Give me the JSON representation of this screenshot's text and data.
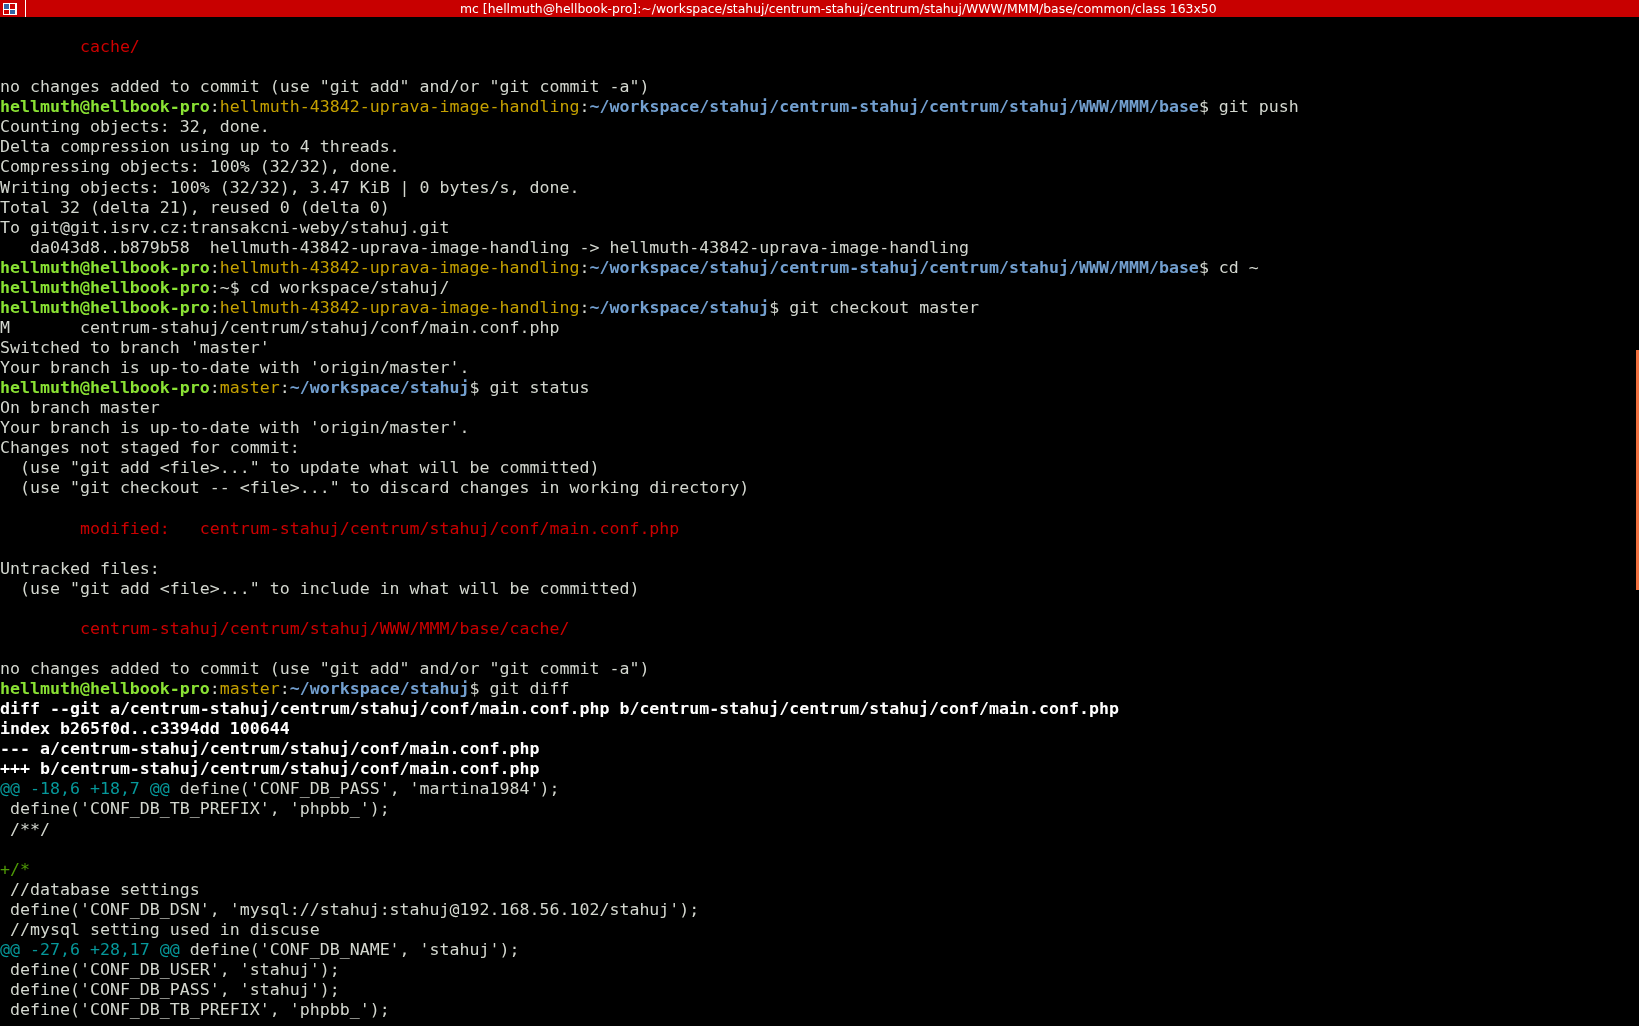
{
  "window": {
    "title": "mc [hellmuth@hellbook-pro]:~/workspace/stahuj/centrum-stahuj/centrum/stahuj/WWW/MMM/base/common/class 163x50"
  },
  "lines": [
    {
      "kind": "blank"
    },
    {
      "kind": "text",
      "segments": [
        {
          "kind": "red",
          "text": "        cache/"
        }
      ]
    },
    {
      "kind": "blank"
    },
    {
      "kind": "text",
      "segments": [
        {
          "kind": "plain",
          "text": "no changes added to commit (use \"git add\" and/or \"git commit -a\")"
        }
      ]
    },
    {
      "kind": "text",
      "segments": [
        {
          "kind": "user",
          "text": "hellmuth@hellbook-pro"
        },
        {
          "kind": "plain",
          "text": ":"
        },
        {
          "kind": "branch",
          "text": "hellmuth-43842-uprava-image-handling"
        },
        {
          "kind": "plain",
          "text": ":"
        },
        {
          "kind": "path",
          "text": "~/workspace/stahuj/centrum-stahuj/centrum/stahuj/WWW/MMM/base"
        },
        {
          "kind": "plain",
          "text": "$ git push"
        }
      ]
    },
    {
      "kind": "text",
      "segments": [
        {
          "kind": "plain",
          "text": "Counting objects: 32, done."
        }
      ]
    },
    {
      "kind": "text",
      "segments": [
        {
          "kind": "plain",
          "text": "Delta compression using up to 4 threads."
        }
      ]
    },
    {
      "kind": "text",
      "segments": [
        {
          "kind": "plain",
          "text": "Compressing objects: 100% (32/32), done."
        }
      ]
    },
    {
      "kind": "text",
      "segments": [
        {
          "kind": "plain",
          "text": "Writing objects: 100% (32/32), 3.47 KiB | 0 bytes/s, done."
        }
      ]
    },
    {
      "kind": "text",
      "segments": [
        {
          "kind": "plain",
          "text": "Total 32 (delta 21), reused 0 (delta 0)"
        }
      ]
    },
    {
      "kind": "text",
      "segments": [
        {
          "kind": "plain",
          "text": "To git@git.isrv.cz:transakcni-weby/stahuj.git"
        }
      ]
    },
    {
      "kind": "text",
      "segments": [
        {
          "kind": "plain",
          "text": "   da043d8..b879b58  hellmuth-43842-uprava-image-handling -> hellmuth-43842-uprava-image-handling"
        }
      ]
    },
    {
      "kind": "text",
      "segments": [
        {
          "kind": "user",
          "text": "hellmuth@hellbook-pro"
        },
        {
          "kind": "plain",
          "text": ":"
        },
        {
          "kind": "branch",
          "text": "hellmuth-43842-uprava-image-handling"
        },
        {
          "kind": "plain",
          "text": ":"
        },
        {
          "kind": "path",
          "text": "~/workspace/stahuj/centrum-stahuj/centrum/stahuj/WWW/MMM/base"
        },
        {
          "kind": "plain",
          "text": "$ cd ~"
        }
      ]
    },
    {
      "kind": "text",
      "segments": [
        {
          "kind": "user",
          "text": "hellmuth@hellbook-pro"
        },
        {
          "kind": "plain",
          "text": ":~$ cd workspace/stahuj/"
        }
      ]
    },
    {
      "kind": "text",
      "segments": [
        {
          "kind": "user",
          "text": "hellmuth@hellbook-pro"
        },
        {
          "kind": "plain",
          "text": ":"
        },
        {
          "kind": "branch",
          "text": "hellmuth-43842-uprava-image-handling"
        },
        {
          "kind": "plain",
          "text": ":"
        },
        {
          "kind": "path",
          "text": "~/workspace/stahuj"
        },
        {
          "kind": "plain",
          "text": "$ git checkout master"
        }
      ]
    },
    {
      "kind": "text",
      "segments": [
        {
          "kind": "plain",
          "text": "M       centrum-stahuj/centrum/stahuj/conf/main.conf.php"
        }
      ]
    },
    {
      "kind": "text",
      "segments": [
        {
          "kind": "plain",
          "text": "Switched to branch 'master'"
        }
      ]
    },
    {
      "kind": "text",
      "segments": [
        {
          "kind": "plain",
          "text": "Your branch is up-to-date with 'origin/master'."
        }
      ]
    },
    {
      "kind": "text",
      "segments": [
        {
          "kind": "user",
          "text": "hellmuth@hellbook-pro"
        },
        {
          "kind": "plain",
          "text": ":"
        },
        {
          "kind": "branch",
          "text": "master"
        },
        {
          "kind": "plain",
          "text": ":"
        },
        {
          "kind": "path",
          "text": "~/workspace/stahuj"
        },
        {
          "kind": "plain",
          "text": "$ git status"
        }
      ]
    },
    {
      "kind": "text",
      "segments": [
        {
          "kind": "plain",
          "text": "On branch master"
        }
      ]
    },
    {
      "kind": "text",
      "segments": [
        {
          "kind": "plain",
          "text": "Your branch is up-to-date with 'origin/master'."
        }
      ]
    },
    {
      "kind": "text",
      "segments": [
        {
          "kind": "plain",
          "text": "Changes not staged for commit:"
        }
      ]
    },
    {
      "kind": "text",
      "segments": [
        {
          "kind": "plain",
          "text": "  (use \"git add <file>...\" to update what will be committed)"
        }
      ]
    },
    {
      "kind": "text",
      "segments": [
        {
          "kind": "plain",
          "text": "  (use \"git checkout -- <file>...\" to discard changes in working directory)"
        }
      ]
    },
    {
      "kind": "blank"
    },
    {
      "kind": "text",
      "segments": [
        {
          "kind": "red",
          "text": "        modified:   centrum-stahuj/centrum/stahuj/conf/main.conf.php"
        }
      ]
    },
    {
      "kind": "blank"
    },
    {
      "kind": "text",
      "segments": [
        {
          "kind": "plain",
          "text": "Untracked files:"
        }
      ]
    },
    {
      "kind": "text",
      "segments": [
        {
          "kind": "plain",
          "text": "  (use \"git add <file>...\" to include in what will be committed)"
        }
      ]
    },
    {
      "kind": "blank"
    },
    {
      "kind": "text",
      "segments": [
        {
          "kind": "red",
          "text": "        centrum-stahuj/centrum/stahuj/WWW/MMM/base/cache/"
        }
      ]
    },
    {
      "kind": "blank"
    },
    {
      "kind": "text",
      "segments": [
        {
          "kind": "plain",
          "text": "no changes added to commit (use \"git add\" and/or \"git commit -a\")"
        }
      ]
    },
    {
      "kind": "text",
      "segments": [
        {
          "kind": "user",
          "text": "hellmuth@hellbook-pro"
        },
        {
          "kind": "plain",
          "text": ":"
        },
        {
          "kind": "branch",
          "text": "master"
        },
        {
          "kind": "plain",
          "text": ":"
        },
        {
          "kind": "path",
          "text": "~/workspace/stahuj"
        },
        {
          "kind": "plain",
          "text": "$ git diff"
        }
      ]
    },
    {
      "kind": "text",
      "segments": [
        {
          "kind": "bold",
          "text": "diff --git a/centrum-stahuj/centrum/stahuj/conf/main.conf.php b/centrum-stahuj/centrum/stahuj/conf/main.conf.php"
        }
      ]
    },
    {
      "kind": "text",
      "segments": [
        {
          "kind": "bold",
          "text": "index b265f0d..c3394dd 100644"
        }
      ]
    },
    {
      "kind": "text",
      "segments": [
        {
          "kind": "bold",
          "text": "--- a/centrum-stahuj/centrum/stahuj/conf/main.conf.php"
        }
      ]
    },
    {
      "kind": "text",
      "segments": [
        {
          "kind": "bold",
          "text": "+++ b/centrum-stahuj/centrum/stahuj/conf/main.conf.php"
        }
      ]
    },
    {
      "kind": "text",
      "segments": [
        {
          "kind": "hunk",
          "text": "@@ -18,6 +18,7 @@"
        },
        {
          "kind": "plain",
          "text": " define('CONF_DB_PASS', 'martina1984');"
        }
      ]
    },
    {
      "kind": "text",
      "segments": [
        {
          "kind": "plain",
          "text": " define('CONF_DB_TB_PREFIX', 'phpbb_');"
        }
      ]
    },
    {
      "kind": "text",
      "segments": [
        {
          "kind": "plain",
          "text": " /**/"
        }
      ]
    },
    {
      "kind": "blank"
    },
    {
      "kind": "text",
      "segments": [
        {
          "kind": "added",
          "text": "+/*"
        }
      ]
    },
    {
      "kind": "text",
      "segments": [
        {
          "kind": "plain",
          "text": " //database settings"
        }
      ]
    },
    {
      "kind": "text",
      "segments": [
        {
          "kind": "plain",
          "text": " define('CONF_DB_DSN', 'mysql://stahuj:stahuj@192.168.56.102/stahuj');"
        }
      ]
    },
    {
      "kind": "text",
      "segments": [
        {
          "kind": "plain",
          "text": " //mysql setting used in discuse"
        }
      ]
    },
    {
      "kind": "text",
      "segments": [
        {
          "kind": "hunk",
          "text": "@@ -27,6 +28,17 @@"
        },
        {
          "kind": "plain",
          "text": " define('CONF_DB_NAME', 'stahuj');"
        }
      ]
    },
    {
      "kind": "text",
      "segments": [
        {
          "kind": "plain",
          "text": " define('CONF_DB_USER', 'stahuj');"
        }
      ]
    },
    {
      "kind": "text",
      "segments": [
        {
          "kind": "plain",
          "text": " define('CONF_DB_PASS', 'stahuj');"
        }
      ]
    },
    {
      "kind": "text",
      "segments": [
        {
          "kind": "plain",
          "text": " define('CONF_DB_TB_PREFIX', 'phpbb_');"
        }
      ]
    }
  ]
}
